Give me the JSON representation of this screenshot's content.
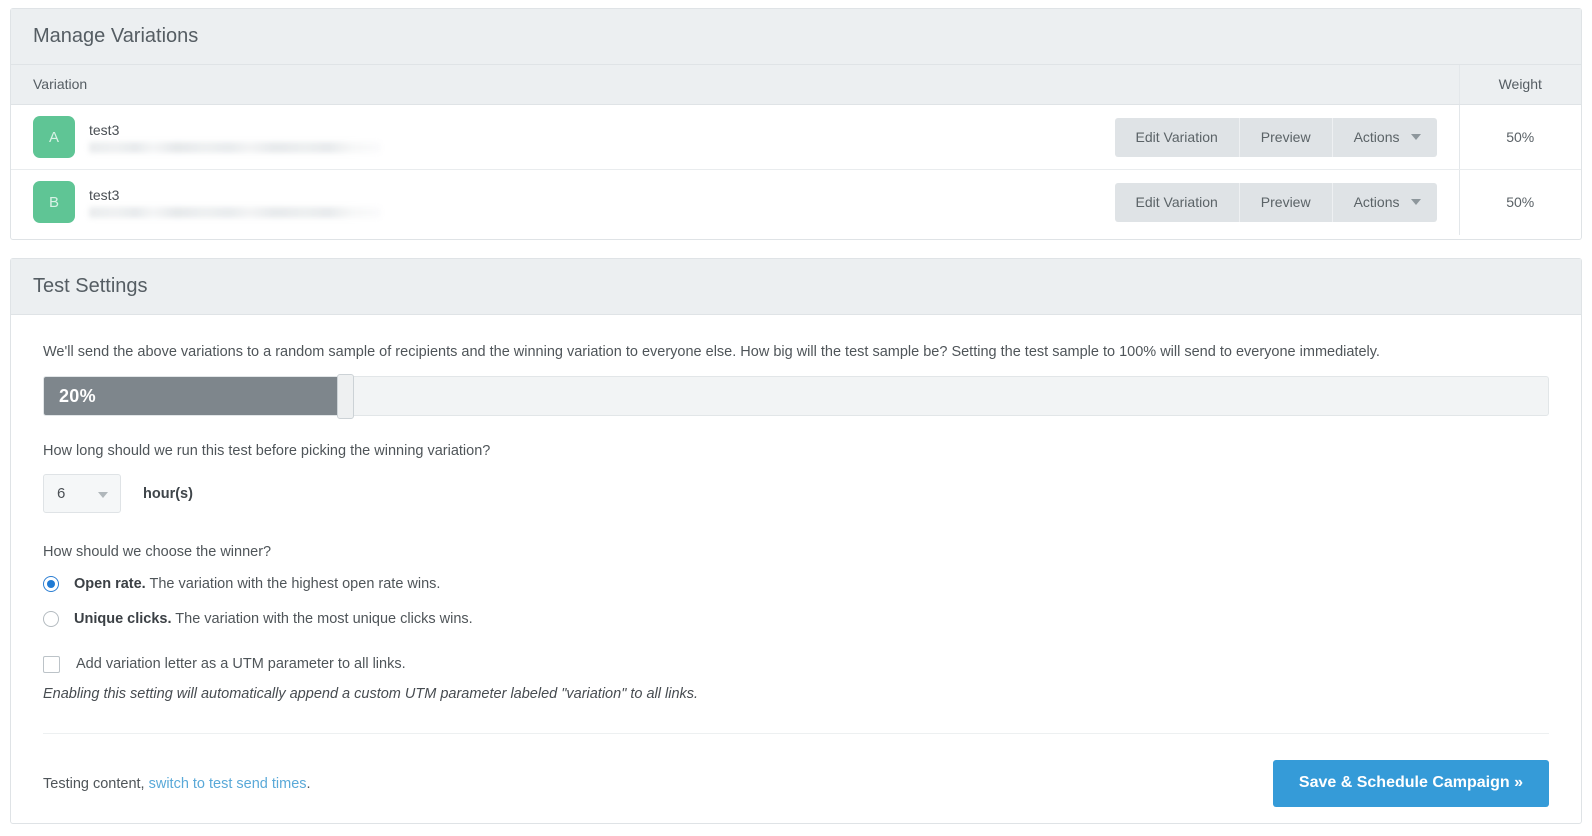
{
  "variations_section": {
    "title": "Manage Variations",
    "columns": {
      "variation": "Variation",
      "weight": "Weight"
    },
    "rows": [
      {
        "letter": "A",
        "name": "test3",
        "url_redacted": "",
        "edit_label": "Edit Variation",
        "preview_label": "Preview",
        "actions_label": "Actions",
        "weight": "50%"
      },
      {
        "letter": "B",
        "name": "test3",
        "url_redacted": "",
        "edit_label": "Edit Variation",
        "preview_label": "Preview",
        "actions_label": "Actions",
        "weight": "50%"
      }
    ]
  },
  "settings_section": {
    "title": "Test Settings",
    "lead_text": "We'll send the above variations to a random sample of recipients and the winning variation to everyone else. How big will the test sample be? Setting the test sample to 100% will send to everyone immediately.",
    "sample_slider": {
      "value_label": "20%",
      "percent": 20
    },
    "duration_question": "How long should we run this test before picking the winning variation?",
    "duration_value": "6",
    "duration_unit": "hour(s)",
    "winner_question": "How should we choose the winner?",
    "winner_options": [
      {
        "selected": true,
        "label_bold": "Open rate.",
        "label_rest": " The variation with the highest open rate wins."
      },
      {
        "selected": false,
        "label_bold": "Unique clicks.",
        "label_rest": " The variation with the most unique clicks wins."
      }
    ],
    "utm_checkbox": {
      "checked": false,
      "label": "Add variation letter as a UTM parameter to all links."
    },
    "utm_note": "Enabling this setting will automatically append a custom UTM parameter labeled \"variation\" to all links.",
    "footer": {
      "text_before": "Testing content, ",
      "link_text": "switch to test send times",
      "text_after": ".",
      "save_label": "Save & Schedule Campaign »"
    }
  },
  "colors": {
    "badge_green": "#5fc595",
    "accent_blue": "#359bd8",
    "link_blue": "#5aa9d8",
    "radio_blue": "#1f7ad4",
    "slider_fill": "#7e868c",
    "panel_head": "#eceff1"
  }
}
